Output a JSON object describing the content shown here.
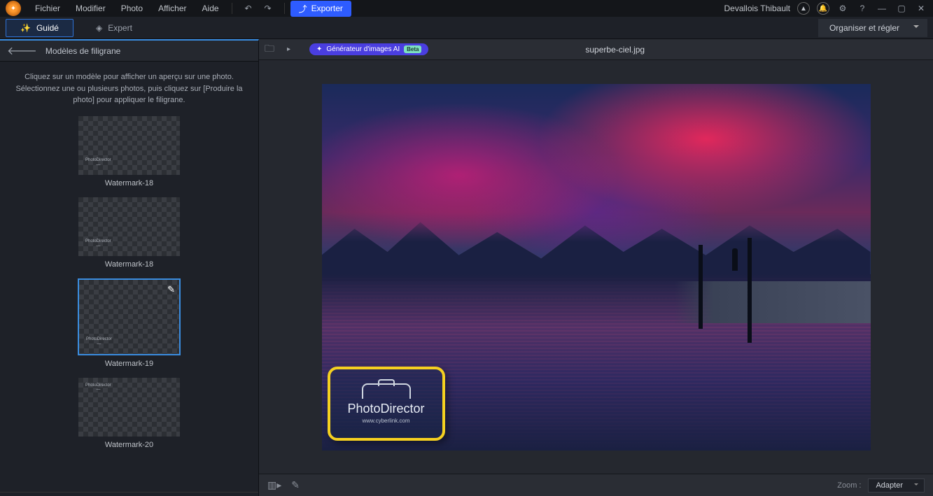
{
  "menu": {
    "items": [
      "Fichier",
      "Modifier",
      "Photo",
      "Afficher",
      "Aide"
    ]
  },
  "export_label": "Exporter",
  "user_name": "Devallois Thibault",
  "modes": {
    "guided": "Guidé",
    "expert": "Expert"
  },
  "organize_label": "Organiser et régler",
  "sidebar": {
    "title": "Modèles de filigrane",
    "description": "Cliquez sur un modèle pour afficher un aperçu sur une photo. Sélectionnez une ou plusieurs photos, puis cliquez sur [Produire la photo] pour appliquer le filigrane.",
    "thumbs": [
      {
        "label": "Watermark-18",
        "selected": false
      },
      {
        "label": "Watermark-18",
        "selected": false
      },
      {
        "label": "Watermark-19",
        "selected": true
      },
      {
        "label": "Watermark-20",
        "selected": false
      }
    ]
  },
  "canvas": {
    "ai_button": "Générateur d'images AI",
    "ai_badge": "Beta",
    "filename": "superbe-ciel.jpg"
  },
  "watermark": {
    "brand": "PhotoDirector",
    "url": "www.cyberlink.com"
  },
  "footer": {
    "zoom_label": "Zoom :",
    "zoom_value": "Adapter"
  }
}
